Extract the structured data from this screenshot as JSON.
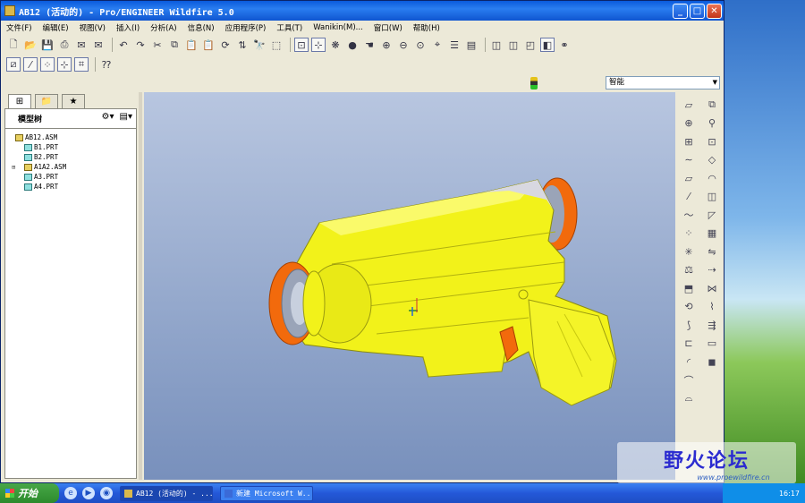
{
  "window": {
    "title": "AB12 (活动的) - Pro/ENGINEER Wildfire 5.0",
    "minimize": "_",
    "maximize": "□",
    "close": "✕"
  },
  "menu": [
    "文件(F)",
    "编辑(E)",
    "视图(V)",
    "插入(I)",
    "分析(A)",
    "信息(N)",
    "应用程序(P)",
    "工具(T)",
    "Wanikin(M)...",
    "窗口(W)",
    "帮助(H)"
  ],
  "filter": {
    "selected": "智能"
  },
  "model_tree": {
    "header": "模型树",
    "items": [
      {
        "label": "AB12.ASM",
        "type": "asm",
        "level": 0
      },
      {
        "label": "B1.PRT",
        "type": "prt",
        "level": 1
      },
      {
        "label": "B2.PRT",
        "type": "prt",
        "level": 1
      },
      {
        "label": "A1A2.ASM",
        "type": "asm",
        "level": 1,
        "expandable": true
      },
      {
        "label": "A3.PRT",
        "type": "prt",
        "level": 1
      },
      {
        "label": "A4.PRT",
        "type": "prt",
        "level": 1
      }
    ]
  },
  "taskbar": {
    "start": "开始",
    "tasks": [
      "AB12 (活动的) - ...",
      "新建 Microsoft W..."
    ],
    "clock": "16:17"
  },
  "watermark": {
    "text": "野火论坛",
    "url": "www.proewildfire.cn"
  },
  "colors": {
    "body_yellow": "#f2f21a",
    "ring_orange": "#f26a0c",
    "viewport_top": "#b8c6e0",
    "viewport_bottom": "#7890bc"
  }
}
